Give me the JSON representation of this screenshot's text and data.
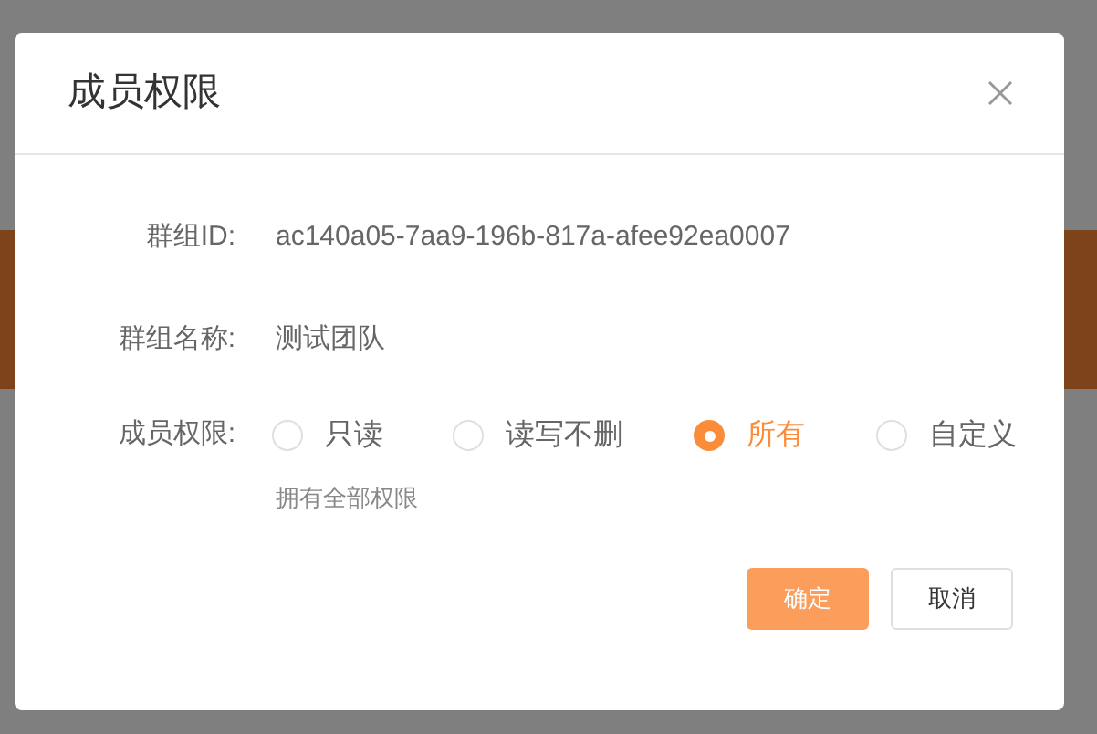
{
  "dialog": {
    "title": "成员权限",
    "fields": [
      {
        "label": "群组ID:",
        "value": "ac140a05-7aa9-196b-817a-afee92ea0007"
      },
      {
        "label": "群组名称:",
        "value": "测试团队"
      }
    ],
    "permission": {
      "label": "成员权限:",
      "options": [
        {
          "label": "只读",
          "selected": false
        },
        {
          "label": "读写不删",
          "selected": false
        },
        {
          "label": "所有",
          "selected": true
        },
        {
          "label": "自定义",
          "selected": false
        }
      ],
      "hint": "拥有全部权限"
    },
    "buttons": [
      {
        "kind": "primary",
        "label": "确定"
      },
      {
        "kind": "secondary",
        "label": "取消"
      }
    ]
  }
}
